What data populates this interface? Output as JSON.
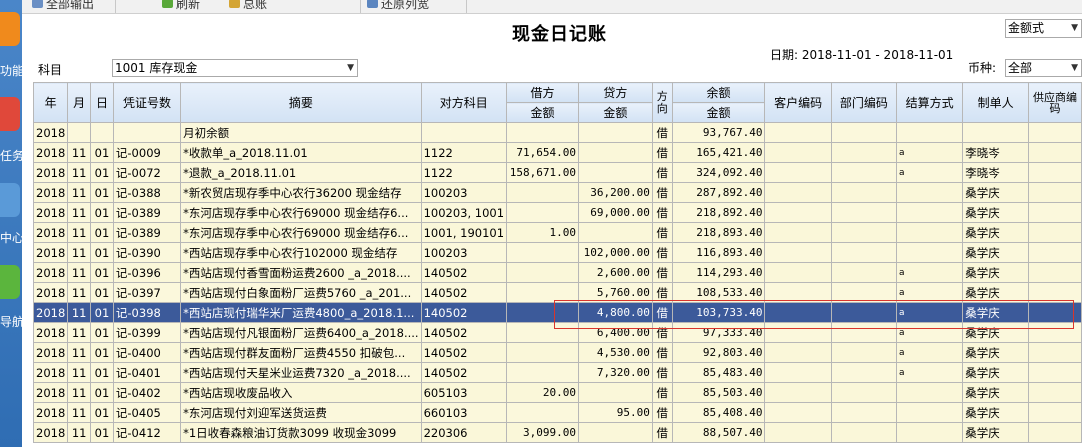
{
  "toolbar": {
    "items": [
      "全部输出",
      "刷新",
      "总账",
      "还原列宽"
    ]
  },
  "sidebar": {
    "items": [
      "功能",
      "任务",
      "中心",
      "导航"
    ]
  },
  "header": {
    "title": "现金日记账",
    "amount_mode": "金额式",
    "date_range": "日期: 2018-11-01 - 2018-11-01",
    "subject_label": "科目",
    "subject_value": "1001 库存现金",
    "currency_label": "币种:",
    "currency_value": "全部"
  },
  "columns": {
    "year": "年",
    "month": "月",
    "day": "日",
    "voucher": "凭证号数",
    "summary": "摘要",
    "counter": "对方科目",
    "debit": "借方",
    "debit_sub": "金额",
    "credit": "贷方",
    "credit_sub": "金额",
    "direction": "方向",
    "balance": "余额",
    "balance_sub": "金额",
    "customer": "客户编码",
    "dept": "部门编码",
    "settle": "结算方式",
    "maker": "制单人",
    "supplier": "供应商编码"
  },
  "rows": [
    {
      "y": "2018",
      "m": "",
      "d": "",
      "v": "",
      "s": "月初余额",
      "c": "",
      "dr": "",
      "cr": "",
      "dir": "借",
      "bal": "93,767.40",
      "settle": "",
      "maker": ""
    },
    {
      "y": "2018",
      "m": "11",
      "d": "01",
      "v": "记-0009",
      "s": "*收款单_a_2018.11.01",
      "c": "1122",
      "dr": "71,654.00",
      "cr": "",
      "dir": "借",
      "bal": "165,421.40",
      "settle": "a",
      "maker": "李晓岑"
    },
    {
      "y": "2018",
      "m": "11",
      "d": "01",
      "v": "记-0072",
      "s": "*退款_a_2018.11.01",
      "c": "1122",
      "dr": "158,671.00",
      "cr": "",
      "dir": "借",
      "bal": "324,092.40",
      "settle": "a",
      "maker": "李晓岑"
    },
    {
      "y": "2018",
      "m": "11",
      "d": "01",
      "v": "记-0388",
      "s": "*新农贸店现存季中心农行36200 现金结存",
      "c": "100203",
      "dr": "",
      "cr": "36,200.00",
      "dir": "借",
      "bal": "287,892.40",
      "settle": "",
      "maker": "桑学庆"
    },
    {
      "y": "2018",
      "m": "11",
      "d": "01",
      "v": "记-0389",
      "s": "*东河店现存季中心农行69000 现金结存6...",
      "c": "100203, 1001",
      "dr": "",
      "cr": "69,000.00",
      "dir": "借",
      "bal": "218,892.40",
      "settle": "",
      "maker": "桑学庆"
    },
    {
      "y": "2018",
      "m": "11",
      "d": "01",
      "v": "记-0389",
      "s": "*东河店现存季中心农行69000 现金结存6...",
      "c": "1001, 190101",
      "dr": "1.00",
      "cr": "",
      "dir": "借",
      "bal": "218,893.40",
      "settle": "",
      "maker": "桑学庆"
    },
    {
      "y": "2018",
      "m": "11",
      "d": "01",
      "v": "记-0390",
      "s": "*西站店现存季中心农行102000 现金结存",
      "c": "100203",
      "dr": "",
      "cr": "102,000.00",
      "dir": "借",
      "bal": "116,893.40",
      "settle": "",
      "maker": "桑学庆"
    },
    {
      "y": "2018",
      "m": "11",
      "d": "01",
      "v": "记-0396",
      "s": "*西站店现付香雪面粉运费2600 _a_2018....",
      "c": "140502",
      "dr": "",
      "cr": "2,600.00",
      "dir": "借",
      "bal": "114,293.40",
      "settle": "a",
      "maker": "桑学庆"
    },
    {
      "y": "2018",
      "m": "11",
      "d": "01",
      "v": "记-0397",
      "s": "*西站店现付白象面粉厂运费5760 _a_201...",
      "c": "140502",
      "dr": "",
      "cr": "5,760.00",
      "dir": "借",
      "bal": "108,533.40",
      "settle": "a",
      "maker": "桑学庆"
    },
    {
      "y": "2018",
      "m": "11",
      "d": "01",
      "v": "记-0398",
      "s": "*西站店现付瑞华米厂运费4800_a_2018.1...",
      "c": "140502",
      "dr": "",
      "cr": "4,800.00",
      "dir": "借",
      "bal": "103,733.40",
      "settle": "a",
      "maker": "桑学庆",
      "selected": true
    },
    {
      "y": "2018",
      "m": "11",
      "d": "01",
      "v": "记-0399",
      "s": "*西站店现付凡银面粉厂运费6400_a_2018....",
      "c": "140502",
      "dr": "",
      "cr": "6,400.00",
      "dir": "借",
      "bal": "97,333.40",
      "settle": "a",
      "maker": "桑学庆"
    },
    {
      "y": "2018",
      "m": "11",
      "d": "01",
      "v": "记-0400",
      "s": "*西站店现付群友面粉厂运费4550 扣破包...",
      "c": "140502",
      "dr": "",
      "cr": "4,530.00",
      "dir": "借",
      "bal": "92,803.40",
      "settle": "a",
      "maker": "桑学庆"
    },
    {
      "y": "2018",
      "m": "11",
      "d": "01",
      "v": "记-0401",
      "s": "*西站店现付天星米业运费7320 _a_2018....",
      "c": "140502",
      "dr": "",
      "cr": "7,320.00",
      "dir": "借",
      "bal": "85,483.40",
      "settle": "a",
      "maker": "桑学庆"
    },
    {
      "y": "2018",
      "m": "11",
      "d": "01",
      "v": "记-0402",
      "s": "*西站店现收废品收入",
      "c": "605103",
      "dr": "20.00",
      "cr": "",
      "dir": "借",
      "bal": "85,503.40",
      "settle": "",
      "maker": "桑学庆"
    },
    {
      "y": "2018",
      "m": "11",
      "d": "01",
      "v": "记-0405",
      "s": "*东河店现付刘迎军送货运费",
      "c": "660103",
      "dr": "",
      "cr": "95.00",
      "dir": "借",
      "bal": "85,408.40",
      "settle": "",
      "maker": "桑学庆"
    },
    {
      "y": "2018",
      "m": "11",
      "d": "01",
      "v": "记-0412",
      "s": "*1日收春森粮油订货款3099 收现金3099",
      "c": "220306",
      "dr": "3,099.00",
      "cr": "",
      "dir": "借",
      "bal": "88,507.40",
      "settle": "",
      "maker": "桑学庆"
    }
  ]
}
